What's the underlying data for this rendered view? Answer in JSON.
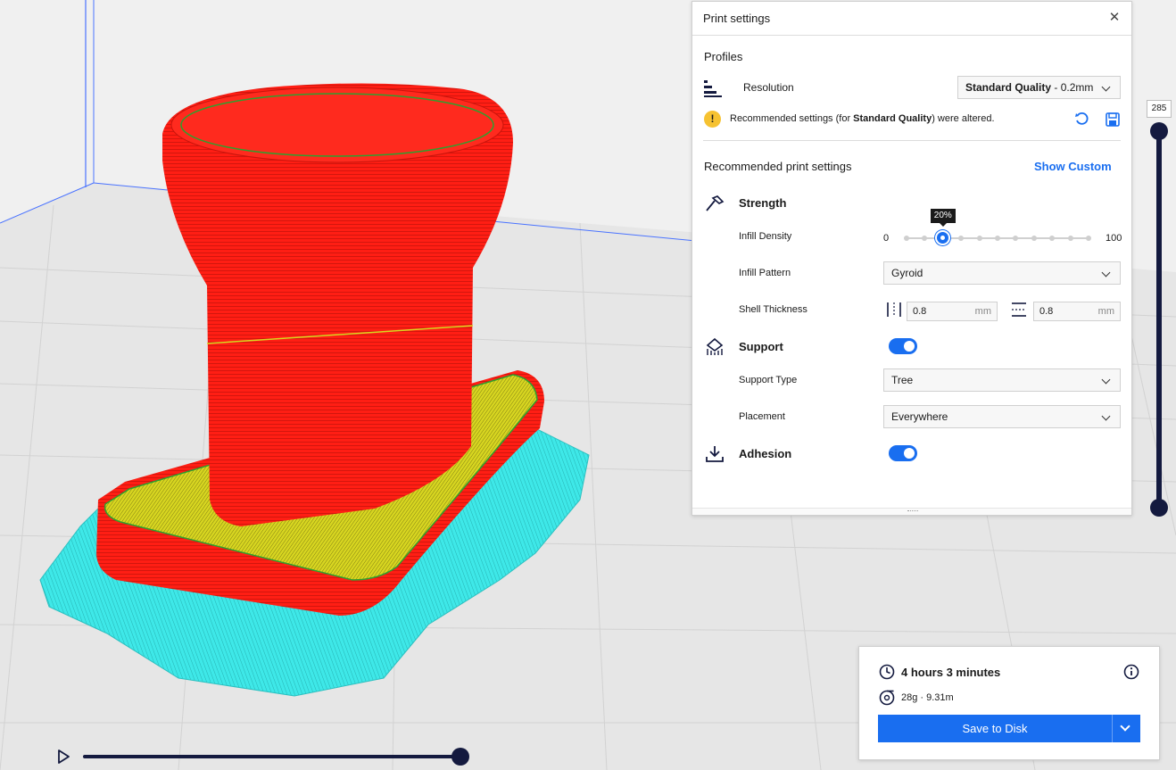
{
  "viewport": {
    "colors": {
      "background": "#f0f0f0",
      "grid": "#d6d6d6",
      "wall": "#ff1e14",
      "infill": "#d4d21f",
      "support": "#3ee8e8",
      "axis_blue": "#4a73ff"
    }
  },
  "print_settings": {
    "title": "Print settings",
    "close_icon": "close-icon",
    "profiles_label": "Profiles",
    "resolution": {
      "label": "Resolution",
      "profile_name": "Standard Quality",
      "profile_suffix": " - 0.2mm"
    },
    "warning": {
      "prefix": "Recommended settings (for ",
      "profile": "Standard Quality",
      "suffix": ") were altered."
    },
    "recommended_title": "Recommended print settings",
    "show_custom": "Show Custom",
    "strength": {
      "title": "Strength",
      "infill_density_label": "Infill Density",
      "infill_min": "0",
      "infill_max": "100",
      "infill_value": 20,
      "infill_value_label": "20%",
      "infill_pattern_label": "Infill Pattern",
      "infill_pattern": "Gyroid",
      "shell_label": "Shell Thickness",
      "wall_thickness": "0.8",
      "top_bottom_thickness": "0.8",
      "unit": "mm"
    },
    "support": {
      "title": "Support",
      "enabled": true,
      "type_label": "Support Type",
      "type": "Tree",
      "placement_label": "Placement",
      "placement": "Everywhere"
    },
    "adhesion": {
      "title": "Adhesion",
      "enabled": true
    },
    "accent": "#196ef0"
  },
  "layer_slider": {
    "value": "285"
  },
  "estimate": {
    "time": "4 hours 3 minutes",
    "material": "28g · 9.31m",
    "save_label": "Save to Disk"
  }
}
